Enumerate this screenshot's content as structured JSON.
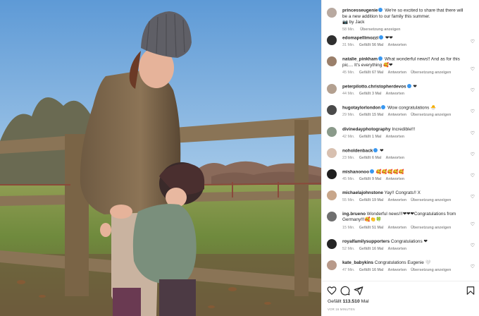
{
  "post": {
    "author": "princesseugenie",
    "caption": "We're so excited to share that there will be a new addition to our family this summer.",
    "credit": "📷 by Jack",
    "time": "58 Min.",
    "translate": "Übersetzung anzeigen"
  },
  "comments": [
    {
      "user": "edomapellimozzi",
      "verified": true,
      "text": "❤❤",
      "time": "31 Min.",
      "likes": "Gefällt 56 Mal",
      "reply": "Antworten",
      "translate": ""
    },
    {
      "user": "natalie_pinkham",
      "verified": true,
      "text": "What wonderful news!! And as for this pic.... It's everything 🥰❤",
      "time": "45 Min.",
      "likes": "Gefällt 67 Mal",
      "reply": "Antworten",
      "translate": "Übersetzung anzeigen"
    },
    {
      "user": "peterpilotto.christopherdevos",
      "verified": true,
      "text": "❤",
      "time": "44 Min.",
      "likes": "Gefällt 3 Mal",
      "reply": "Antworten",
      "translate": ""
    },
    {
      "user": "hugotaylorlondon",
      "verified": true,
      "text": "Wow congratulations 🐣",
      "time": "29 Min.",
      "likes": "Gefällt 15 Mal",
      "reply": "Antworten",
      "translate": "Übersetzung anzeigen"
    },
    {
      "user": "divinedayphotography",
      "verified": false,
      "text": "Incredible!!!",
      "time": "42 Min.",
      "likes": "Gefällt 1 Mal",
      "reply": "Antworten",
      "translate": ""
    },
    {
      "user": "noholdenback",
      "verified": true,
      "text": "❤",
      "time": "23 Min.",
      "likes": "Gefällt 6 Mal",
      "reply": "Antworten",
      "translate": ""
    },
    {
      "user": "mishanonoo",
      "verified": true,
      "text": "🥰🥰🥰🥰🥰",
      "time": "45 Min.",
      "likes": "Gefällt 9 Mal",
      "reply": "Antworten",
      "translate": ""
    },
    {
      "user": "michaelajohnstone",
      "verified": false,
      "text": "Yay!! Congrats!! X",
      "time": "55 Min.",
      "likes": "Gefällt 19 Mal",
      "reply": "Antworten",
      "translate": "Übersetzung anzeigen"
    },
    {
      "user": "ing.brueno",
      "verified": false,
      "text": "Wonderful news!!!❤❤❤Congratulations from Germany!!!🥰👏🍀",
      "time": "15 Min.",
      "likes": "Gefällt 51 Mal",
      "reply": "Antworten",
      "translate": "Übersetzung anzeigen"
    },
    {
      "user": "royalfamilysupporters",
      "verified": false,
      "text": "Congratulations ❤",
      "time": "52 Min.",
      "likes": "Gefällt 16 Mal",
      "reply": "Antworten",
      "translate": ""
    },
    {
      "user": "kate_babykins",
      "verified": false,
      "text": "Congratulations Eugenie 🤍",
      "time": "47 Min.",
      "likes": "Gefällt 16 Mal",
      "reply": "Antworten",
      "translate": "Übersetzung anzeigen"
    }
  ],
  "footer": {
    "likes_label": "Gefällt",
    "likes_count": "113.510",
    "likes_suffix": "Mal",
    "timestamp": "VOR 16 MINUTEN"
  },
  "icons": {
    "like": "heart-icon",
    "comment": "comment-icon",
    "share": "share-icon",
    "save": "bookmark-icon",
    "comment_like": "small-heart-icon"
  },
  "colors": {
    "verified": "#3897f0",
    "heart": "#ed4956",
    "meta": "#8e8e8e",
    "text": "#262626"
  }
}
